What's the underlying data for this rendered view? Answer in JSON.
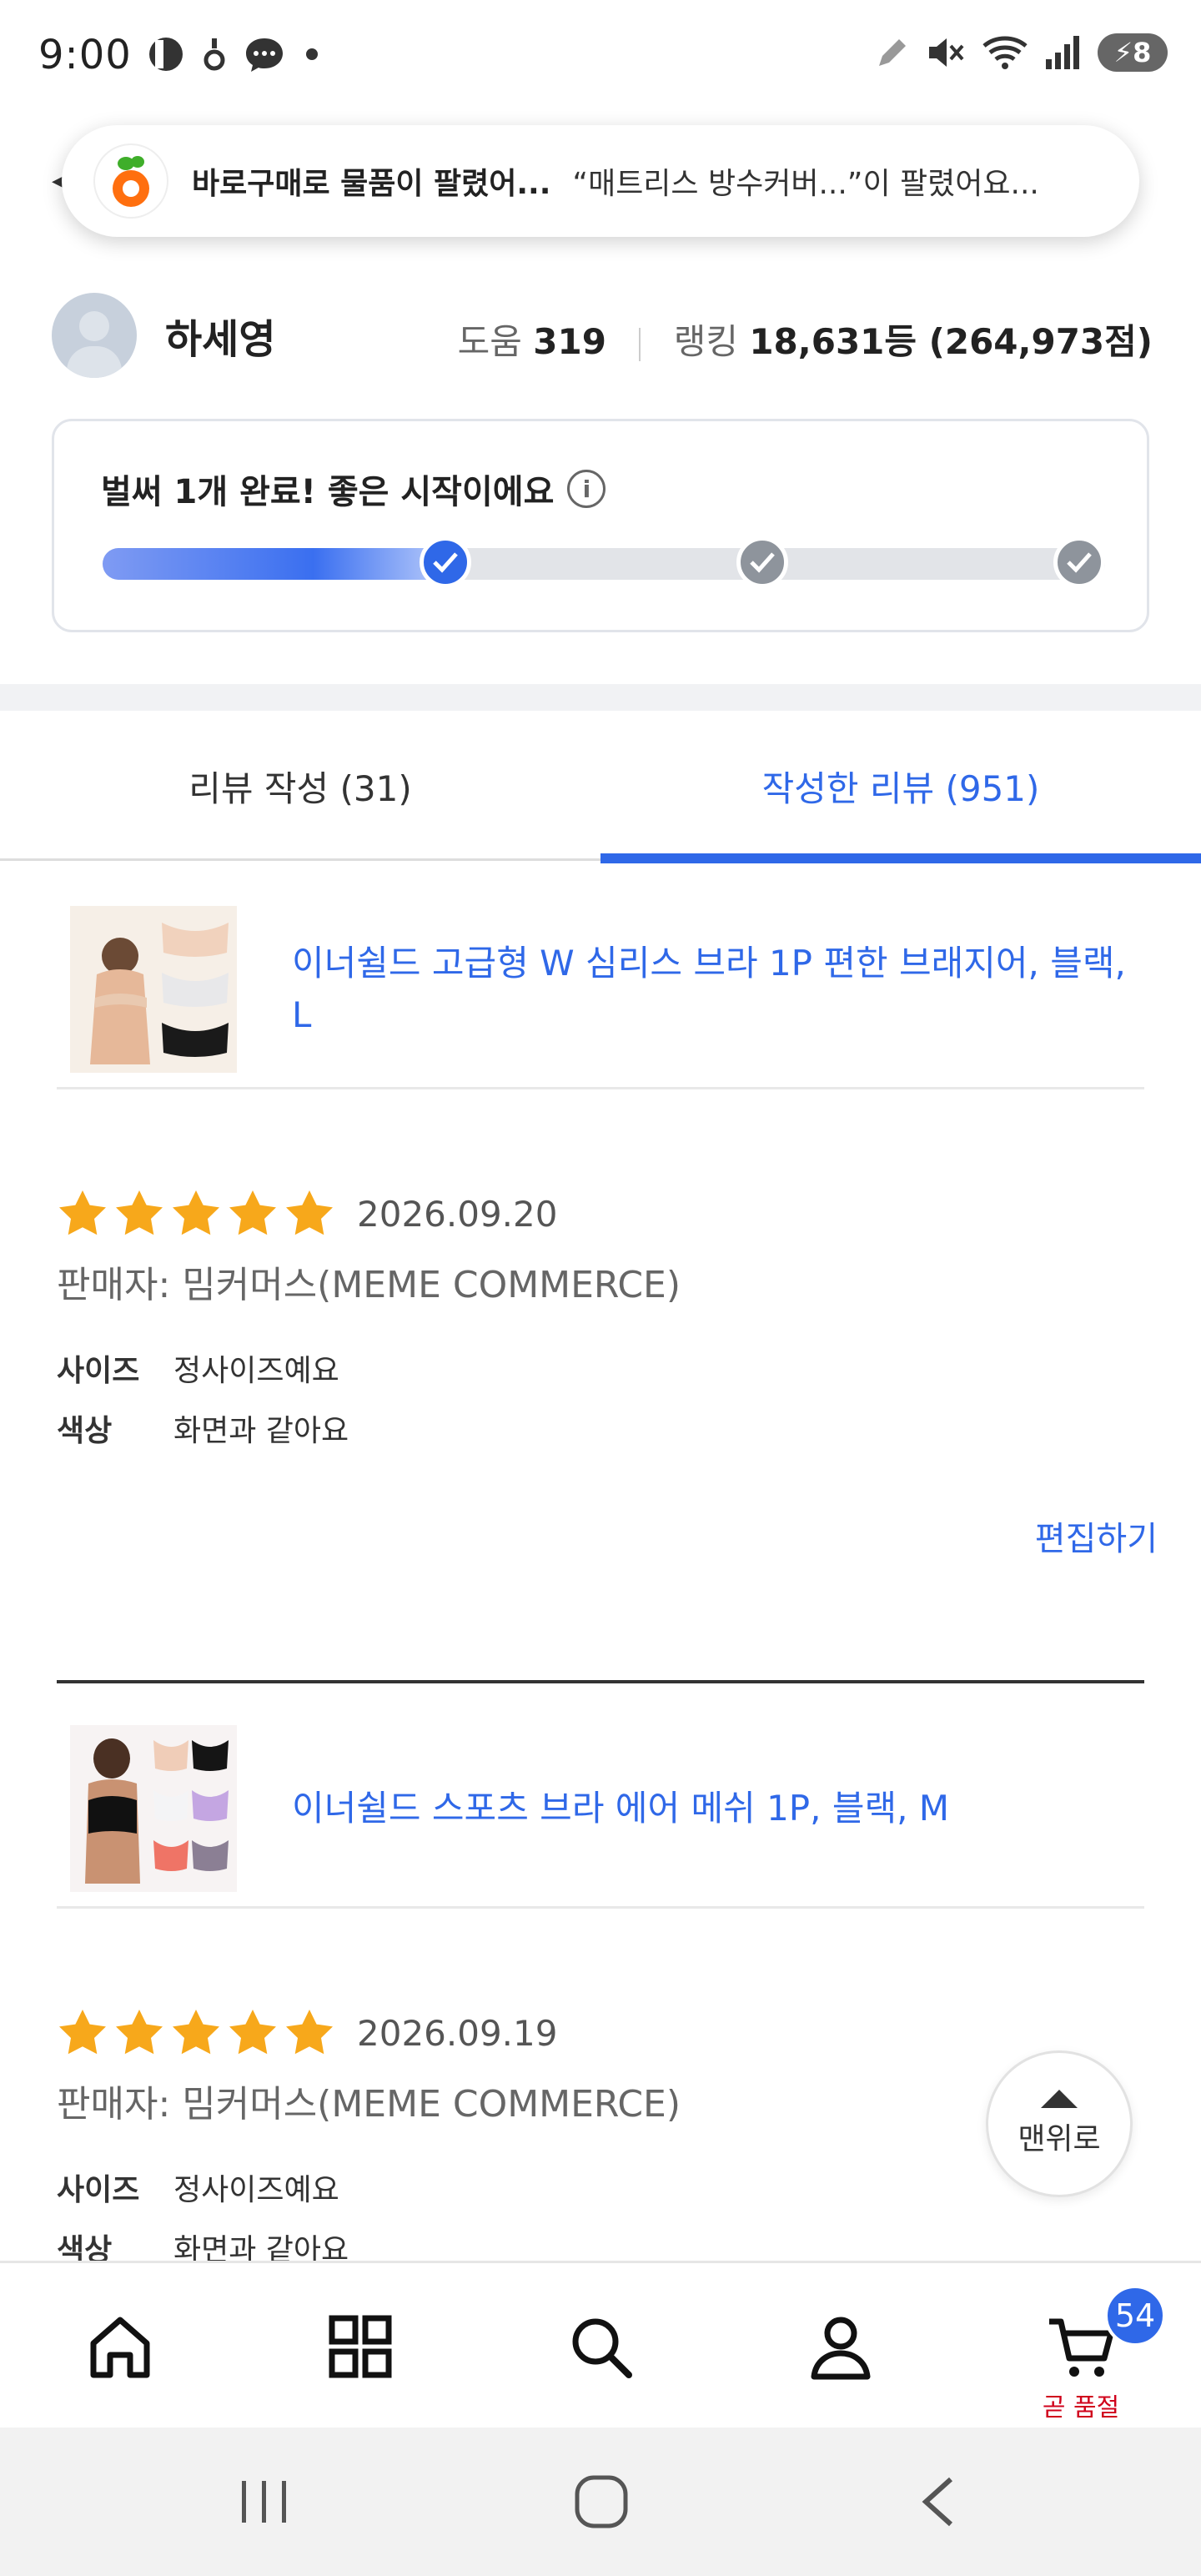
{
  "status_bar": {
    "time": "9:00",
    "battery": "8",
    "icons": [
      "bixby-icon",
      "ring-icon",
      "chat-bubble-icon",
      "dot-icon",
      "pen-icon",
      "mute-icon",
      "wifi-icon",
      "signal-icon",
      "battery-icon"
    ]
  },
  "notification": {
    "title": "바로구매로 물품이 팔렸어...",
    "body": "“매트리스 방수커버...”이 팔렸어요..."
  },
  "profile": {
    "name": "하세영",
    "help_label": "도움",
    "help_value": "319",
    "ranking_label": "랭킹",
    "ranking_value": "18,631등 (264,973점)"
  },
  "progress": {
    "title": "벌써 1개 완료! 좋은 시작이에요",
    "info_symbol": "i",
    "completed": 1,
    "total": 3,
    "fill_fraction": 0.35
  },
  "tabs": [
    {
      "label": "리뷰 작성 (31)",
      "active": false
    },
    {
      "label": "작성한 리뷰 (951)",
      "active": true
    }
  ],
  "reviews": [
    {
      "product": "이너쉴드 고급형 W 심리스 브라 1P 편한 브래지어, 블랙, L",
      "rating": 5,
      "date": "2026.09.20",
      "seller": "판매자: 밈커머스(MEME COMMERCE)",
      "attributes": [
        {
          "key": "사이즈",
          "value": "정사이즈예요"
        },
        {
          "key": "색상",
          "value": "화면과 같아요"
        }
      ],
      "edit_label": "편집하기"
    },
    {
      "product": "이너쉴드 스포츠 브라 에어 메쉬 1P, 블랙, M",
      "rating": 5,
      "date": "2026.09.19",
      "seller": "판매자: 밈커머스(MEME COMMERCE)",
      "attributes": [
        {
          "key": "사이즈",
          "value": "정사이즈예요"
        },
        {
          "key": "색상",
          "value": "화면과 같아요"
        }
      ]
    }
  ],
  "top_button": {
    "label": "맨위로"
  },
  "bottom_nav": {
    "items": [
      "home-icon",
      "category-grid-icon",
      "search-icon",
      "my-account-icon",
      "cart-icon"
    ],
    "cart_badge": "54",
    "cart_note": "곧 품절"
  },
  "colors": {
    "accent": "#2f68e8",
    "star": "#f7a81b",
    "soldout": "#d0021b"
  }
}
